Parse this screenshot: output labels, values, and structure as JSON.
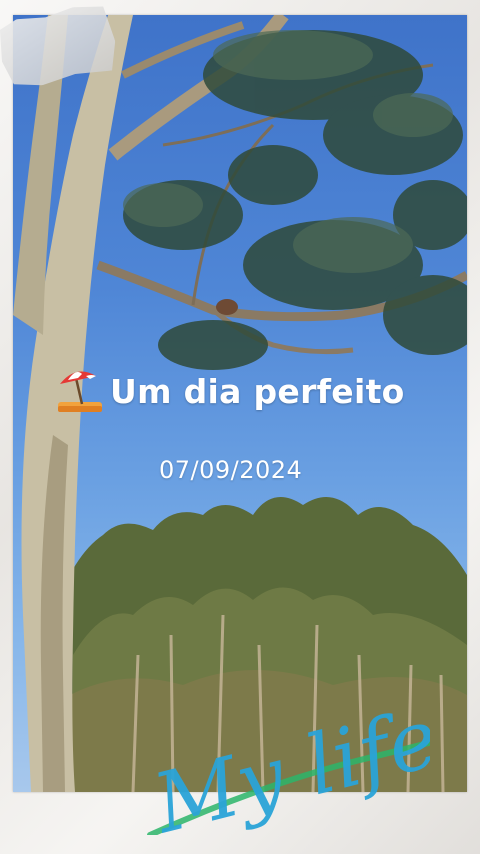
{
  "overlay": {
    "title": "Um dia perfeito",
    "date": "07/09/2024",
    "script_text": "My life",
    "title_icon": "beach-umbrella-icon"
  },
  "colors": {
    "sky": "#4f86d6",
    "script": "#2aa4d8",
    "brush": "#2bb56a",
    "paper": "#f1efec"
  }
}
